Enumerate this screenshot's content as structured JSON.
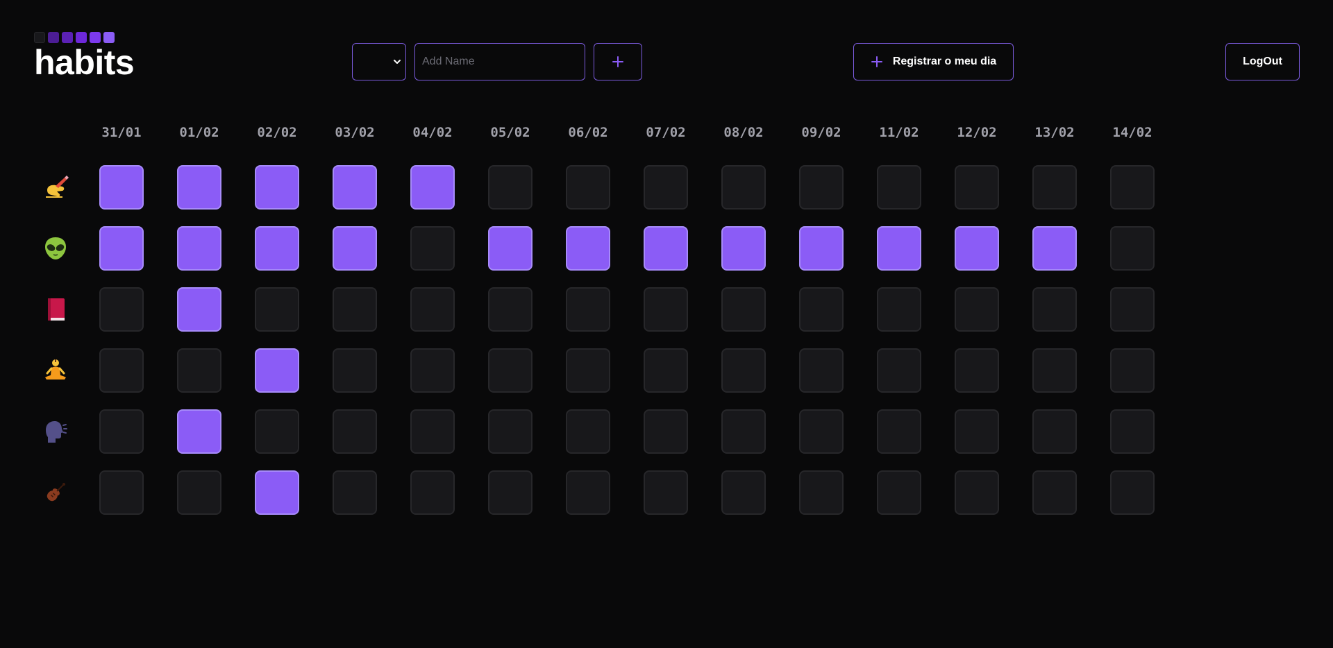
{
  "app": {
    "title": "habits",
    "logo_square_colors": [
      "#18181b",
      "#4c1d95",
      "#5b21b6",
      "#6d28d9",
      "#7c3aed",
      "#8b5cf6"
    ]
  },
  "toolbar": {
    "add_name_placeholder": "Add Name",
    "register_label": "Registrar o meu dia",
    "logout_label": "LogOut"
  },
  "colors": {
    "accent": "#8b5cf6",
    "accent_border": "#a78bfa",
    "empty_cell": "#18181b",
    "empty_border": "#27272a",
    "button_border": "#7c5cdf",
    "background": "#09090a"
  },
  "dates": [
    "31/01",
    "01/02",
    "02/02",
    "03/02",
    "04/02",
    "05/02",
    "06/02",
    "07/02",
    "08/02",
    "09/02",
    "11/02",
    "12/02",
    "13/02",
    "14/02"
  ],
  "habits": [
    {
      "icon": "writing-hand-icon",
      "completed": [
        1,
        1,
        1,
        1,
        1,
        0,
        0,
        0,
        0,
        0,
        0,
        0,
        0,
        0
      ]
    },
    {
      "icon": "alien-icon",
      "completed": [
        1,
        1,
        1,
        1,
        0,
        1,
        1,
        1,
        1,
        1,
        1,
        1,
        1,
        0
      ]
    },
    {
      "icon": "book-icon",
      "completed": [
        0,
        1,
        0,
        0,
        0,
        0,
        0,
        0,
        0,
        0,
        0,
        0,
        0,
        0
      ]
    },
    {
      "icon": "meditation-icon",
      "completed": [
        0,
        0,
        1,
        0,
        0,
        0,
        0,
        0,
        0,
        0,
        0,
        0,
        0,
        0
      ]
    },
    {
      "icon": "speaking-head-icon",
      "completed": [
        0,
        1,
        0,
        0,
        0,
        0,
        0,
        0,
        0,
        0,
        0,
        0,
        0,
        0
      ]
    },
    {
      "icon": "violin-icon",
      "completed": [
        0,
        0,
        1,
        0,
        0,
        0,
        0,
        0,
        0,
        0,
        0,
        0,
        0,
        0
      ]
    }
  ]
}
